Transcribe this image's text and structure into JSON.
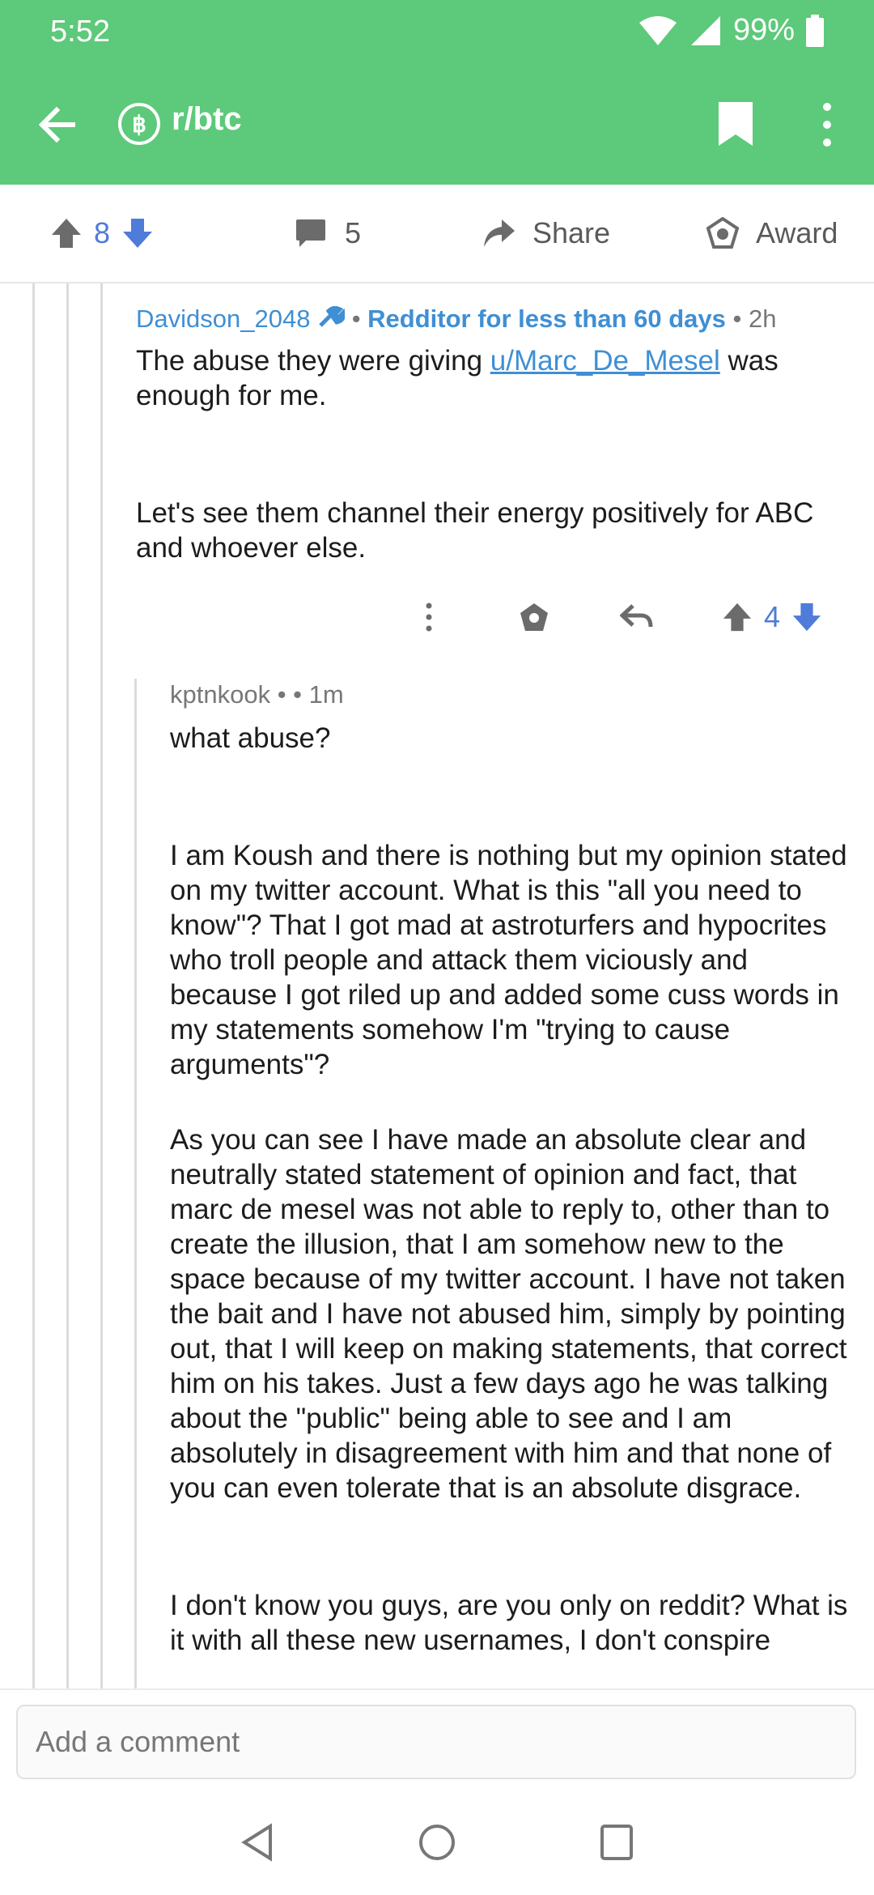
{
  "status_bar": {
    "time": "5:52",
    "battery": "99%"
  },
  "app_bar": {
    "subreddit": "r/btc",
    "sub_icon_letter": "฿"
  },
  "action_bar": {
    "score": "8",
    "comments": "5",
    "share": "Share",
    "award": "Award"
  },
  "parent_comment": {
    "author": "Davidson_2048",
    "flair": "Redditor for less than 60 days",
    "age": "2h",
    "body_prefix": "The abuse they were giving ",
    "mention": "u/Marc_De_Mesel",
    "body_suffix": " was enough for me.",
    "paragraph2": "Let's see them channel their energy positively for ABC and whoever else.",
    "score": "4"
  },
  "reply_comment": {
    "author": "kptnkook",
    "age": "1m",
    "paragraphs": [
      "what abuse?",
      "I am Koush and there is nothing but my opinion stated on my twitter account. What is this \"all you need to know\"? That I got mad at astroturfers and hypocrites who troll people and attack them viciously and because I got riled up and added some cuss words in my statements somehow I'm \"trying to cause arguments\"?",
      "As you can see I have made an absolute clear and neutrally stated statement of opinion and fact, that marc de mesel was not able to reply to, other than to create the illusion, that I am somehow new to the space because of my twitter account. I have not taken the bait and I have not abused him, simply by pointing out, that I will keep on making statements, that correct him on his takes. Just a few days ago he was talking about the \"public\" being able to see and I am absolutely in disagreement with him and that none of you can even tolerate that is an absolute disgrace.",
      "I don't know you guys, are you only on reddit? What is it with all these new usernames, I don't conspire"
    ]
  },
  "comment_input": {
    "placeholder": "Add a comment"
  },
  "colors": {
    "header": "#5dc97a",
    "accent": "#3f8fd4",
    "vote": "#4f7bd9",
    "icon": "#6b6b6b"
  }
}
